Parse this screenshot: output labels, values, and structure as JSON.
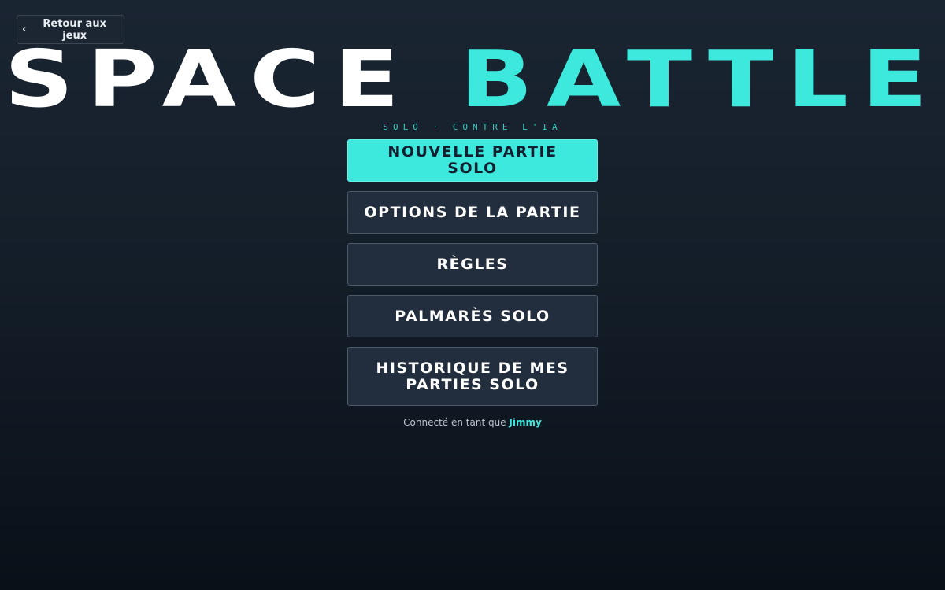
{
  "nav": {
    "back_chevron": "‹",
    "back_label": "Retour aux jeux"
  },
  "title": {
    "part1": "SPACE",
    "part2": "BATTLE"
  },
  "subtitle": "SOLO · CONTRE L'IA",
  "menu": {
    "items": [
      {
        "label": "NOUVELLE PARTIE SOLO"
      },
      {
        "label": "OPTIONS DE LA PARTIE"
      },
      {
        "label": "RÈGLES"
      },
      {
        "label": "PALMARÈS SOLO"
      },
      {
        "label": "HISTORIQUE DE MES PARTIES SOLO"
      }
    ]
  },
  "login": {
    "prefix": "Connecté en tant que",
    "username": "Jimmy"
  },
  "colors": {
    "accent": "#3de8dc",
    "background": "#141e29",
    "button_bg": "#222e3d"
  }
}
